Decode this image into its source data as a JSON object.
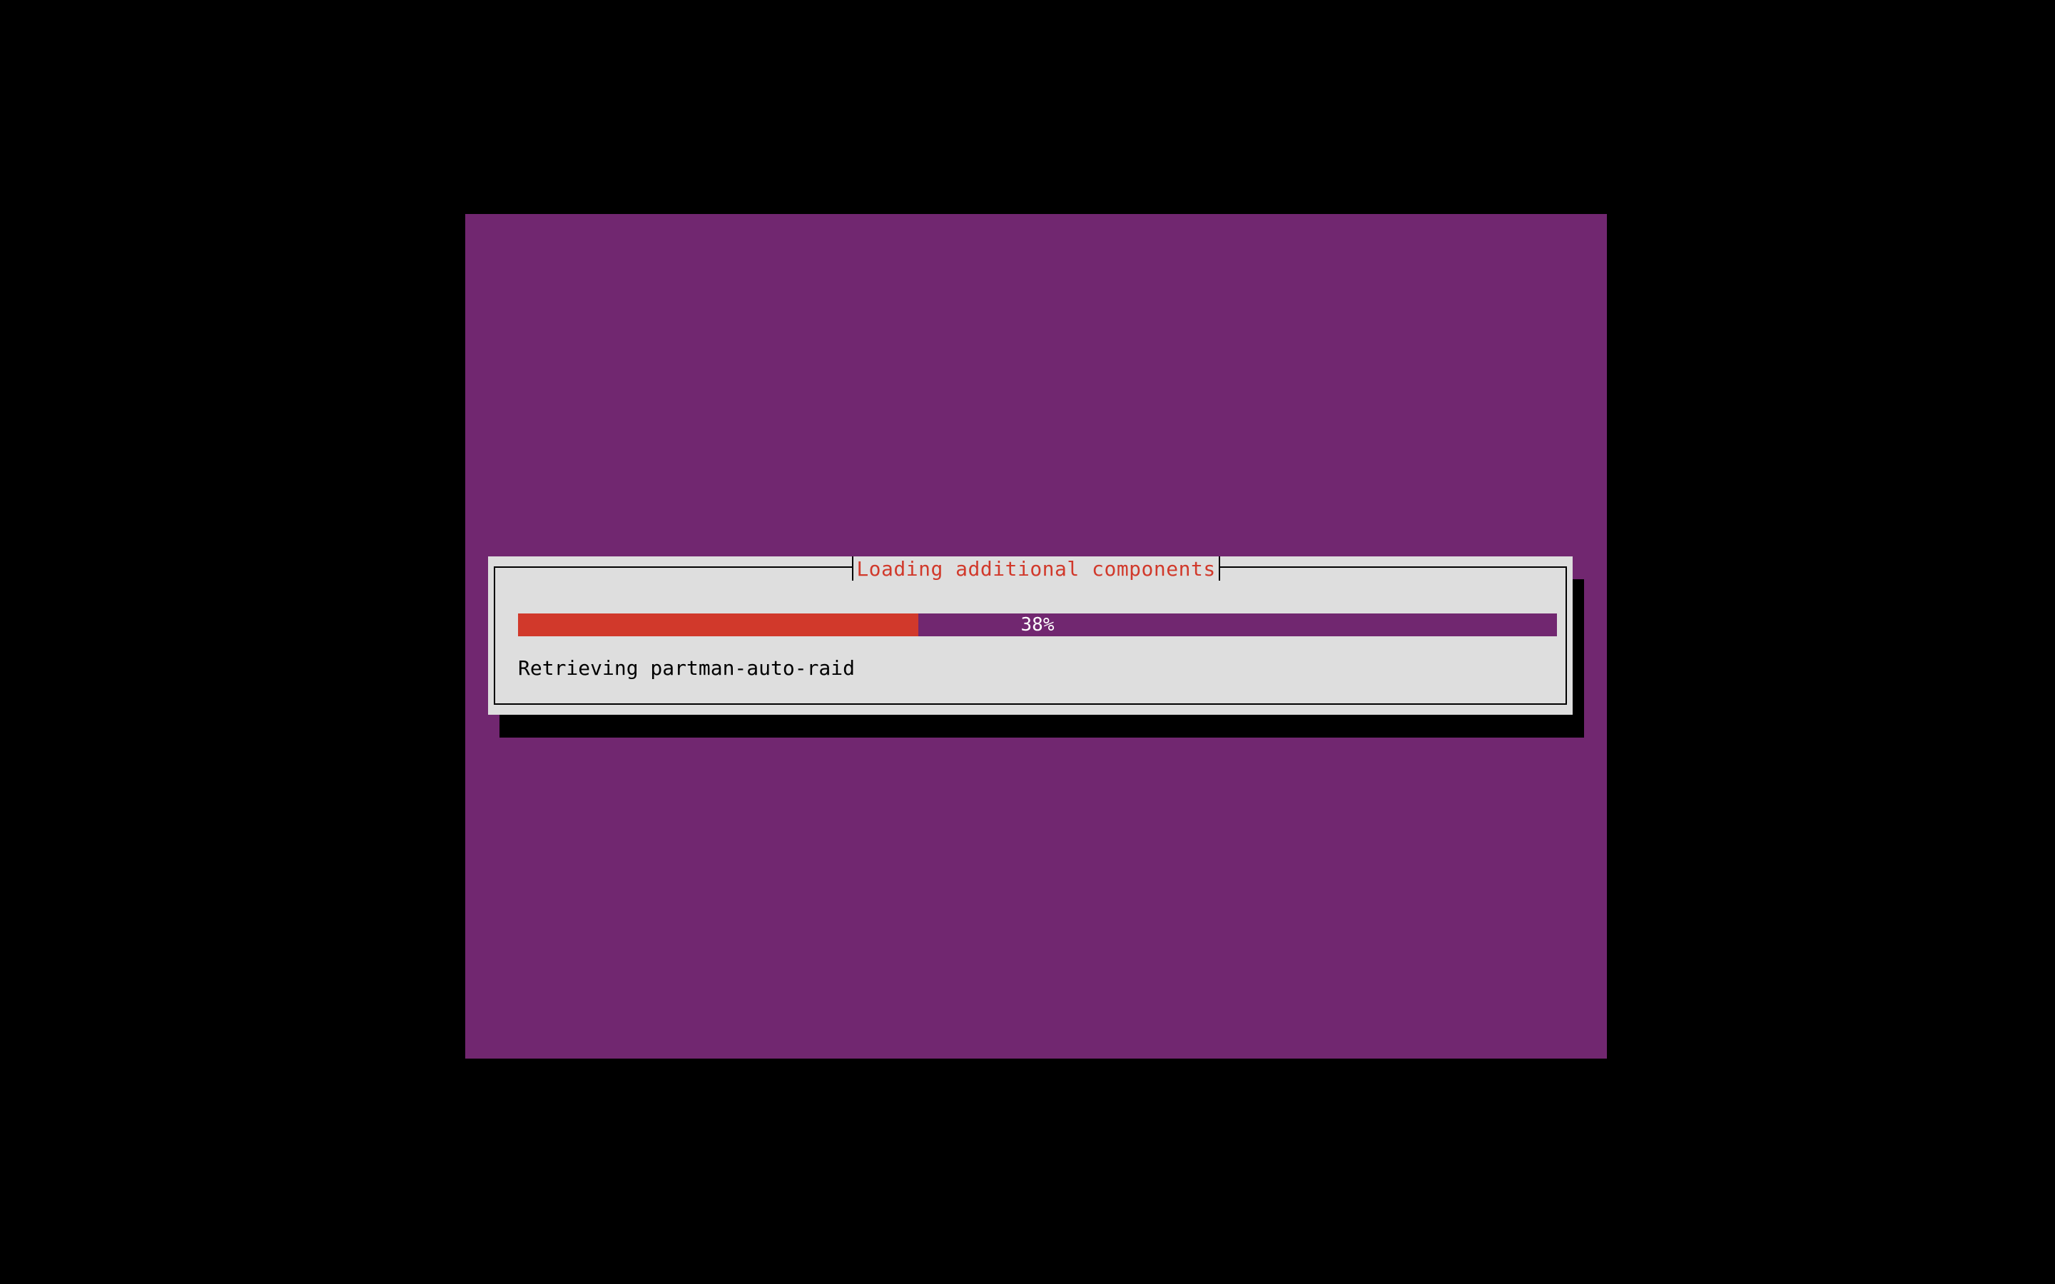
{
  "dialog": {
    "title": "Loading additional components",
    "progress_label": "38%",
    "progress_fraction": 0.385,
    "status": "Retrieving partman-auto-raid"
  },
  "colors": {
    "background": "#000000",
    "screen": "#712770",
    "dialog": "#dedede",
    "accent": "#d1392b"
  }
}
